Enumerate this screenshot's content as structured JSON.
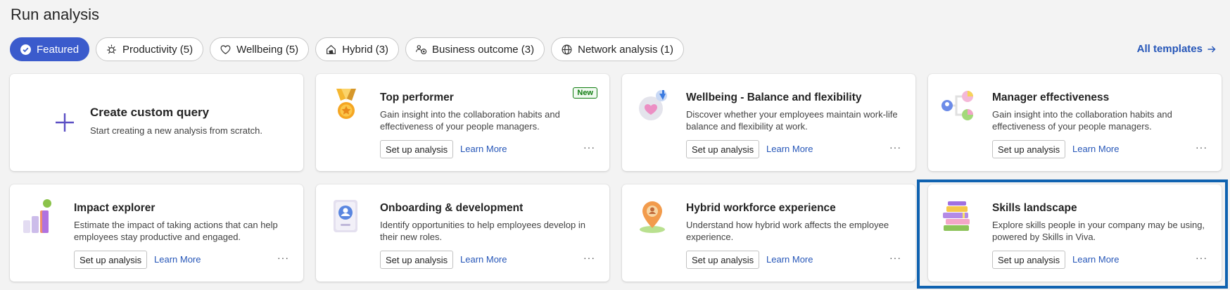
{
  "page": {
    "title": "Run analysis"
  },
  "filters": [
    {
      "label": "Featured",
      "icon": "check-circle-icon",
      "active": true
    },
    {
      "label": "Productivity (5)",
      "icon": "sparkle-icon",
      "active": false
    },
    {
      "label": "Wellbeing (5)",
      "icon": "heart-icon",
      "active": false
    },
    {
      "label": "Hybrid (3)",
      "icon": "hybrid-icon",
      "active": false
    },
    {
      "label": "Business outcome (3)",
      "icon": "people-target-icon",
      "active": false
    },
    {
      "label": "Network analysis (1)",
      "icon": "globe-icon",
      "active": false
    }
  ],
  "all_templates": {
    "label": "All templates",
    "icon": "arrow-right-icon"
  },
  "create_card": {
    "title": "Create custom query",
    "description": "Start creating a new analysis from scratch.",
    "icon": "plus-icon"
  },
  "cards": [
    {
      "title": "Top performer",
      "description": "Gain insight into the collaboration habits and effectiveness of your people managers.",
      "badge": "New",
      "icon": "medal-icon",
      "setup": "Set up analysis",
      "learn": "Learn More",
      "more": "···"
    },
    {
      "title": "Wellbeing - Balance and flexibility",
      "description": "Discover whether your employees maintain work-life balance and flexibility at work.",
      "icon": "wellbeing-heart-icon",
      "setup": "Set up analysis",
      "learn": "Learn More",
      "more": "···"
    },
    {
      "title": "Manager effectiveness",
      "description": "Gain insight into the collaboration habits and effectiveness of your people managers.",
      "icon": "org-chart-icon",
      "setup": "Set up analysis",
      "learn": "Learn More",
      "more": "···"
    },
    {
      "title": "Impact explorer",
      "description": "Estimate the impact of taking actions that can help employees stay productive and engaged.",
      "icon": "bar-chart-icon",
      "setup": "Set up analysis",
      "learn": "Learn More",
      "more": "···"
    },
    {
      "title": "Onboarding & development",
      "description": "Identify opportunities to help employees develop in their new roles.",
      "icon": "badge-id-icon",
      "setup": "Set up analysis",
      "learn": "Learn More",
      "more": "···"
    },
    {
      "title": "Hybrid workforce experience",
      "description": "Understand how hybrid work affects the employee experience.",
      "icon": "location-pin-icon",
      "setup": "Set up analysis",
      "learn": "Learn More",
      "more": "···"
    },
    {
      "title": "Skills landscape",
      "description": "Explore skills people in your company may be using, powered by Skills in Viva.",
      "icon": "books-icon",
      "setup": "Set up analysis",
      "learn": "Learn More",
      "more": "···",
      "selected": true
    }
  ],
  "colors": {
    "accent": "#3b5bcc",
    "link": "#2656b8",
    "selection": "#0f62b0",
    "new_badge": "#107c10"
  }
}
